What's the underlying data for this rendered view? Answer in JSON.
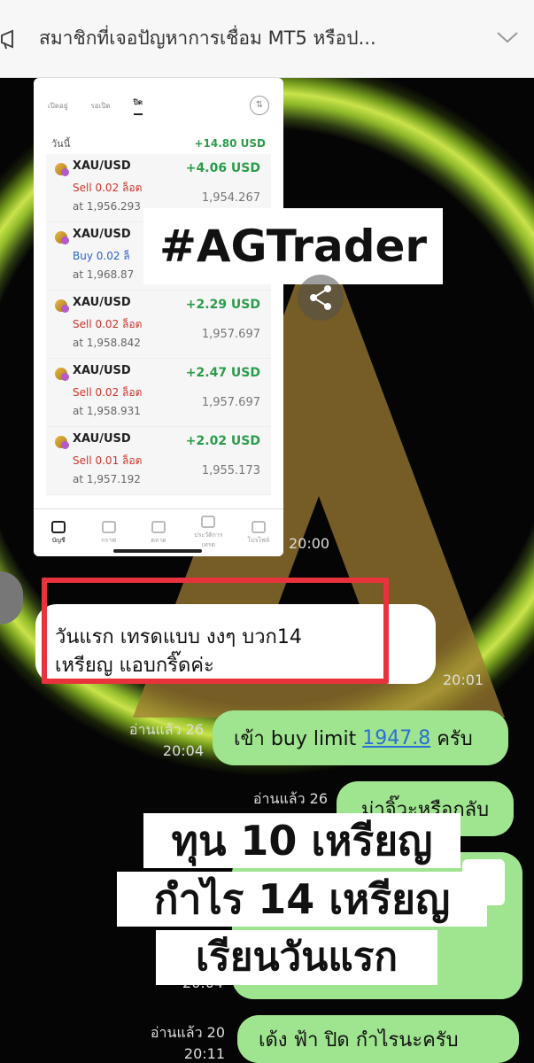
{
  "notification": {
    "text": "สมาชิกที่เจอปัญหาการเชื่อม MT5 หรือป...",
    "icon": "megaphone-icon",
    "chevron": "chevron-down-icon"
  },
  "embedded_screenshot": {
    "tabs": [
      "เปิดอยู่",
      "รอเปิด",
      "ปิด"
    ],
    "today_label": "วันนี้",
    "today_pnl": "+14.80 USD",
    "positions": [
      {
        "symbol": "XAU/USD",
        "side": "Sell 0.02 ล็อต",
        "side_type": "sell",
        "at": "at 1,956.293",
        "profit": "+4.06 USD",
        "current": "1,954.267"
      },
      {
        "symbol": "XAU/USD",
        "side": "Buy 0.02 ล็",
        "side_type": "buy",
        "at": "at 1,968.87",
        "profit": "",
        "current": ""
      },
      {
        "symbol": "XAU/USD",
        "side": "Sell 0.02 ล็อต",
        "side_type": "sell",
        "at": "at 1,958.842",
        "profit": "+2.29 USD",
        "current": "1,957.697"
      },
      {
        "symbol": "XAU/USD",
        "side": "Sell 0.02 ล็อต",
        "side_type": "sell",
        "at": "at 1,958.931",
        "profit": "+2.47 USD",
        "current": "1,957.697"
      },
      {
        "symbol": "XAU/USD",
        "side": "Sell 0.01 ล็อต",
        "side_type": "sell",
        "at": "at 1,957.192",
        "profit": "+2.02 USD",
        "current": "1,955.173"
      }
    ],
    "nav": [
      "บัญชี",
      "กราฟ",
      "ตลาด",
      "ประวัติการเทรด",
      "โปรไฟล์"
    ]
  },
  "overlay_tag": "#AGTrader",
  "messages": {
    "time_1": "20:00",
    "incoming_text_line1": "วันแรก เทรดแบบ  งงๆ บวก14",
    "incoming_text_line2": "เหรียญ  แอบกริ๊ดค่ะ",
    "incoming_time": "20:01",
    "out1_prefix": "เข้า buy limit ",
    "out1_link": "1947.8",
    "out1_suffix": " ครับ",
    "out1_read": "อ่านแล้ว 26",
    "out1_time": "20:04",
    "out2_read": "อ่านแล้ว 26",
    "out2_text": "ม่าจิ๊วะหรือกลับ",
    "out3_time": "20:04",
    "out4_read": "อ่านแล้ว 20",
    "out4_time": "20:11",
    "out4_text": "เด้ง ฟ้า ปิด กำไรนะครับ"
  },
  "caption": {
    "line1": "ทุน 10 เหรียญ",
    "line2": "กำไร 14 เหรียญ",
    "line3": "เรียนวันแรก"
  }
}
